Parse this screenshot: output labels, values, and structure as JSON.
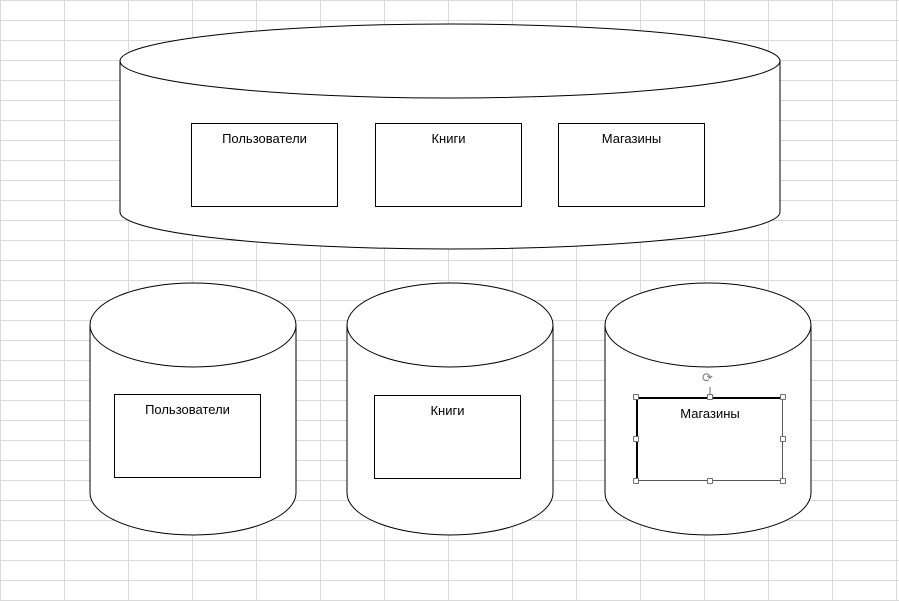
{
  "main_database": {
    "tables": [
      {
        "label": "Пользователи"
      },
      {
        "label": "Книги"
      },
      {
        "label": "Магазины"
      }
    ]
  },
  "shards": [
    {
      "table": {
        "label": "Пользователи"
      }
    },
    {
      "table": {
        "label": "Книги"
      }
    },
    {
      "table": {
        "label": "Магазины",
        "selected": true
      }
    }
  ],
  "colors": {
    "gridline": "#d9d9d9",
    "shape_stroke": "#000000",
    "selection_handle": "#6e6e6e"
  },
  "icons": {
    "rotate": "rotate-handle-icon"
  }
}
